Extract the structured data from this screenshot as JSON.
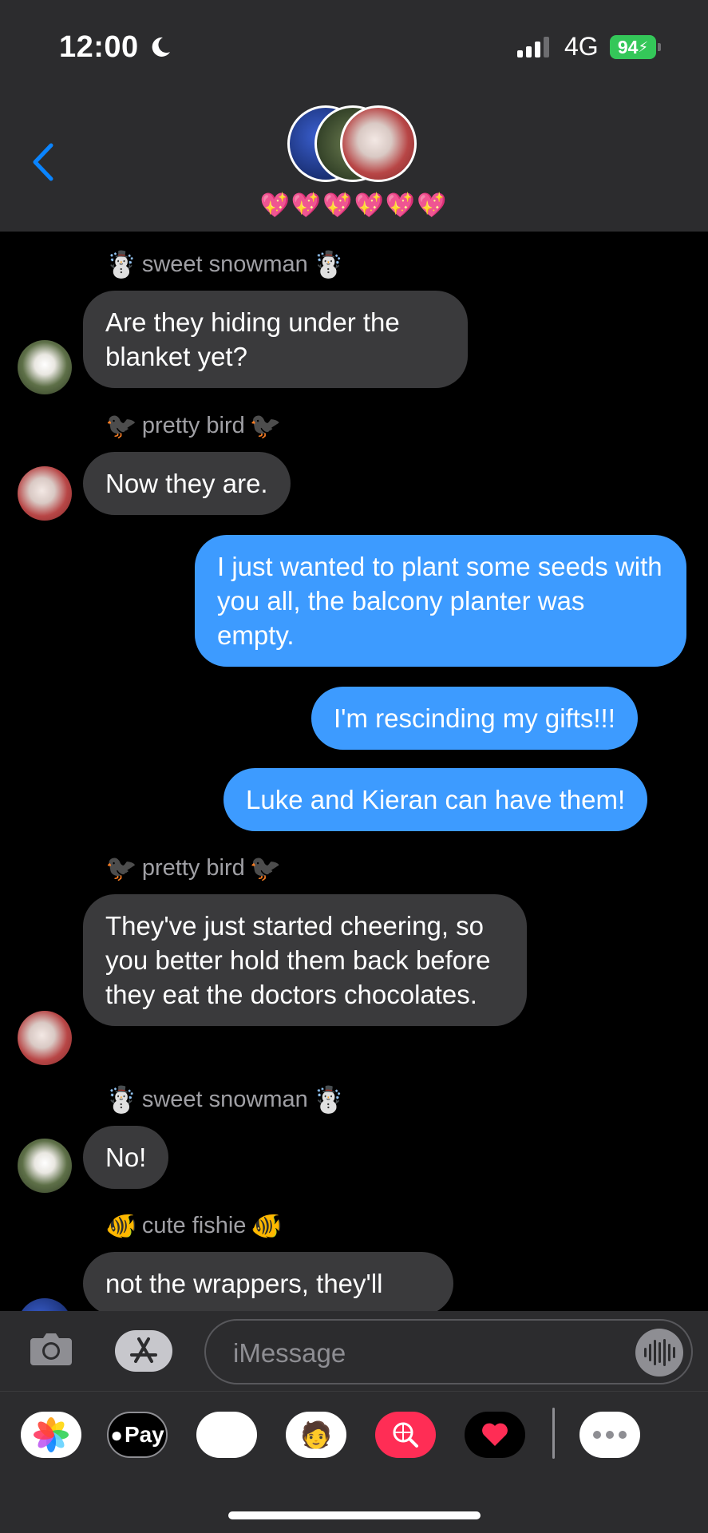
{
  "status_bar": {
    "time": "12:00",
    "network": "4G",
    "battery": "94"
  },
  "header": {
    "hearts": "💖💖💖💖💖💖"
  },
  "messages": [
    {
      "sender_left_emoji": "☃️",
      "sender_name": "sweet snowman",
      "sender_right_emoji": "☃️"
    },
    {
      "text": "Are they hiding under the blanket yet?"
    },
    {
      "sender_left_emoji": "🐦‍⬛",
      "sender_name": "pretty bird",
      "sender_right_emoji": "🐦‍⬛"
    },
    {
      "text": "Now they are."
    },
    {
      "text": "I just wanted to plant some seeds with you all, the balcony planter was empty."
    },
    {
      "text": "I'm rescinding my gifts!!!"
    },
    {
      "text": "Luke and Kieran can have them!"
    },
    {
      "sender_left_emoji": "🐦‍⬛",
      "sender_name": "pretty bird",
      "sender_right_emoji": "🐦‍⬛"
    },
    {
      "text": "They've just started cheering, so you better hold them back before they eat the doctors chocolates."
    },
    {
      "sender_left_emoji": "☃️",
      "sender_name": "sweet snowman",
      "sender_right_emoji": "☃️"
    },
    {
      "text": "No!"
    },
    {
      "sender_left_emoji": "🐠",
      "sender_name": "cute fishie",
      "sender_right_emoji": "🐠"
    },
    {
      "text": "not the wrappers, they'll"
    }
  ],
  "input": {
    "placeholder": "iMessage"
  },
  "apps": {
    "pay_label": "Pay"
  },
  "colors": {
    "outgoing_bubble": "#3d9bff",
    "incoming_bubble": "#3a3a3c",
    "battery": "#34c759",
    "accent": "#0a84ff"
  }
}
